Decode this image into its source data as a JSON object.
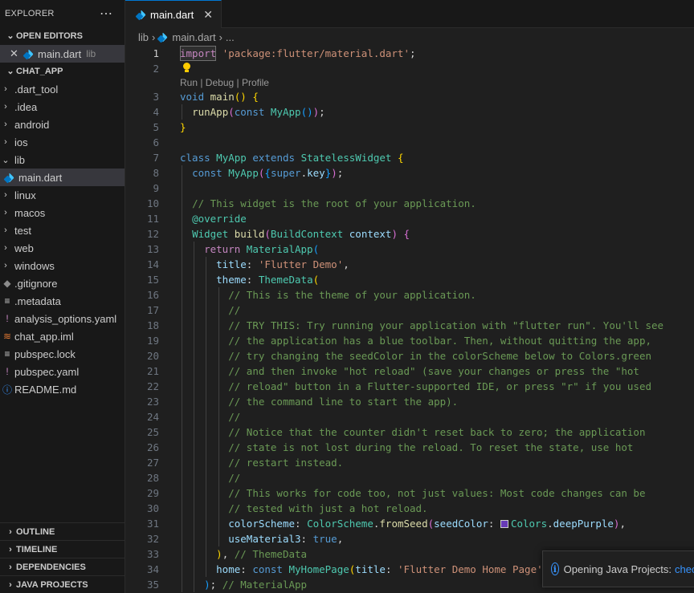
{
  "sidebar": {
    "title": "EXPLORER",
    "more_icon": "ellipsis-icon",
    "open_editors": {
      "title": "OPEN EDITORS",
      "items": [
        {
          "name": "main.dart",
          "description": "lib"
        }
      ]
    },
    "project": {
      "title": "CHAT_APP",
      "items": [
        {
          "label": ".dart_tool",
          "type": "folder"
        },
        {
          "label": ".idea",
          "type": "folder"
        },
        {
          "label": "android",
          "type": "folder"
        },
        {
          "label": "ios",
          "type": "folder"
        },
        {
          "label": "lib",
          "type": "folder-open"
        },
        {
          "label": "main.dart",
          "type": "dart"
        },
        {
          "label": "linux",
          "type": "folder"
        },
        {
          "label": "macos",
          "type": "folder"
        },
        {
          "label": "test",
          "type": "folder"
        },
        {
          "label": "web",
          "type": "folder"
        },
        {
          "label": "windows",
          "type": "folder"
        },
        {
          "label": ".gitignore",
          "type": "git"
        },
        {
          "label": ".metadata",
          "type": "lines"
        },
        {
          "label": "analysis_options.yaml",
          "type": "yaml"
        },
        {
          "label": "chat_app.iml",
          "type": "rss"
        },
        {
          "label": "pubspec.lock",
          "type": "lines"
        },
        {
          "label": "pubspec.yaml",
          "type": "yaml"
        },
        {
          "label": "README.md",
          "type": "info"
        }
      ]
    },
    "bottom_sections": [
      "OUTLINE",
      "TIMELINE",
      "DEPENDENCIES",
      "JAVA PROJECTS"
    ]
  },
  "editor": {
    "tab": {
      "label": "main.dart",
      "close": "✕"
    },
    "breadcrumb": [
      "lib",
      "main.dart",
      "..."
    ],
    "codelens": "Run | Debug | Profile",
    "line_numbers": [
      "1",
      "2",
      "3",
      "4",
      "5",
      "6",
      "7",
      "8",
      "9",
      "10",
      "11",
      "12",
      "13",
      "14",
      "15",
      "16",
      "17",
      "18",
      "19",
      "20",
      "21",
      "22",
      "23",
      "24",
      "25",
      "26",
      "27",
      "28",
      "29",
      "30",
      "31",
      "32",
      "33",
      "34",
      "35"
    ],
    "comments": {
      "l10": "// This widget is the root of your application.",
      "l16": "// This is the theme of your application.",
      "l17": "//",
      "l18": "// TRY THIS: Try running your application with \"flutter run\". You'll see",
      "l19": "// the application has a blue toolbar. Then, without quitting the app,",
      "l20": "// try changing the seedColor in the colorScheme below to Colors.green",
      "l21": "// and then invoke \"hot reload\" (save your changes or press the \"hot",
      "l22": "// reload\" button in a Flutter-supported IDE, or press \"r\" if you used",
      "l23": "// the command line to start the app).",
      "l24": "//",
      "l25": "// Notice that the counter didn't reset back to zero; the application",
      "l26": "// state is not lost during the reload. To reset the state, use hot",
      "l27": "// restart instead.",
      "l28": "//",
      "l29": "// This works for code too, not just values: Most code changes can be",
      "l30": "// tested with just a hot reload.",
      "l33": "// ThemeData",
      "l35": "// MaterialApp"
    },
    "strings": {
      "import_path": "'package:flutter/material.dart'",
      "title": "'Flutter Demo'",
      "home_title": "'Flutter Demo Home Page'"
    },
    "swatch_color": "#673ab7"
  },
  "notification": {
    "icon": "info-icon",
    "text": "Opening Java Projects:",
    "link": "check"
  }
}
